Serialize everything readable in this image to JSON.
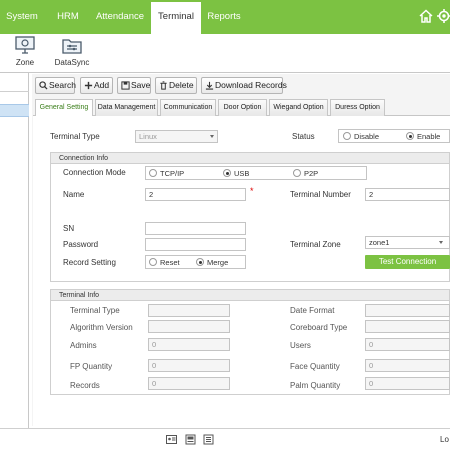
{
  "nav": {
    "tabs": [
      {
        "label": "System"
      },
      {
        "label": "HRM"
      },
      {
        "label": "Attendance"
      },
      {
        "label": "Terminal"
      },
      {
        "label": "Reports"
      }
    ],
    "active_tab": "Terminal",
    "icons": [
      "home-icon",
      "settings-gear-icon"
    ]
  },
  "modules": [
    {
      "label": "Zone",
      "icon": "zone-monitor-icon"
    },
    {
      "label": "DataSync",
      "icon": "datasync-icon"
    }
  ],
  "toolbar": {
    "search": "Search",
    "add": "Add",
    "save": "Save",
    "delete": "Delete",
    "download": "Download Records"
  },
  "subtabs": [
    {
      "label": "General Setting"
    },
    {
      "label": "Data Management"
    },
    {
      "label": "Communication"
    },
    {
      "label": "Door Option"
    },
    {
      "label": "Wiegand Option"
    },
    {
      "label": "Duress Option"
    }
  ],
  "general": {
    "terminal_type_label": "Terminal Type",
    "terminal_type_value": "Linux",
    "status_label": "Status",
    "status_options": [
      "Disable",
      "Enable"
    ],
    "status_selected": "Enable"
  },
  "connection": {
    "title": "Connection Info",
    "mode_label": "Connection Mode",
    "mode_options": [
      "TCP/IP",
      "USB",
      "P2P"
    ],
    "mode_selected": "USB",
    "name_label": "Name",
    "name_value": "2",
    "required_mark": "*",
    "terminal_number_label": "Terminal Number",
    "terminal_number_value": "2",
    "sn_label": "SN",
    "sn_value": "",
    "password_label": "Password",
    "password_value": "",
    "terminal_zone_label": "Terminal Zone",
    "terminal_zone_value": "zone1",
    "record_setting_label": "Record Setting",
    "record_options": [
      "Reset",
      "Merge"
    ],
    "record_selected": "Merge",
    "test_button": "Test Connection"
  },
  "terminal_info": {
    "title": "Terminal Info",
    "terminal_type_label": "Terminal Type",
    "algorithm_label": "Algorithm Version",
    "admins_label": "Admins",
    "admins_value": "0",
    "fp_label": "FP Quantity",
    "fp_value": "0",
    "records_label": "Records",
    "records_value": "0",
    "date_format_label": "Date Format",
    "coreboard_label": "Coreboard Type",
    "users_label": "Users",
    "users_value": "0",
    "face_label": "Face Quantity",
    "face_value": "0",
    "palm_label": "Palm Quantity",
    "palm_value": "0"
  },
  "footer": {
    "icons": [
      "id-card-icon",
      "terminal-device-icon",
      "records-book-icon"
    ],
    "corner_text": "Lo"
  },
  "colors": {
    "accent_green": "#7cc242",
    "active_tab_text": "#3a7e1a",
    "required_red": "#dd0000"
  }
}
